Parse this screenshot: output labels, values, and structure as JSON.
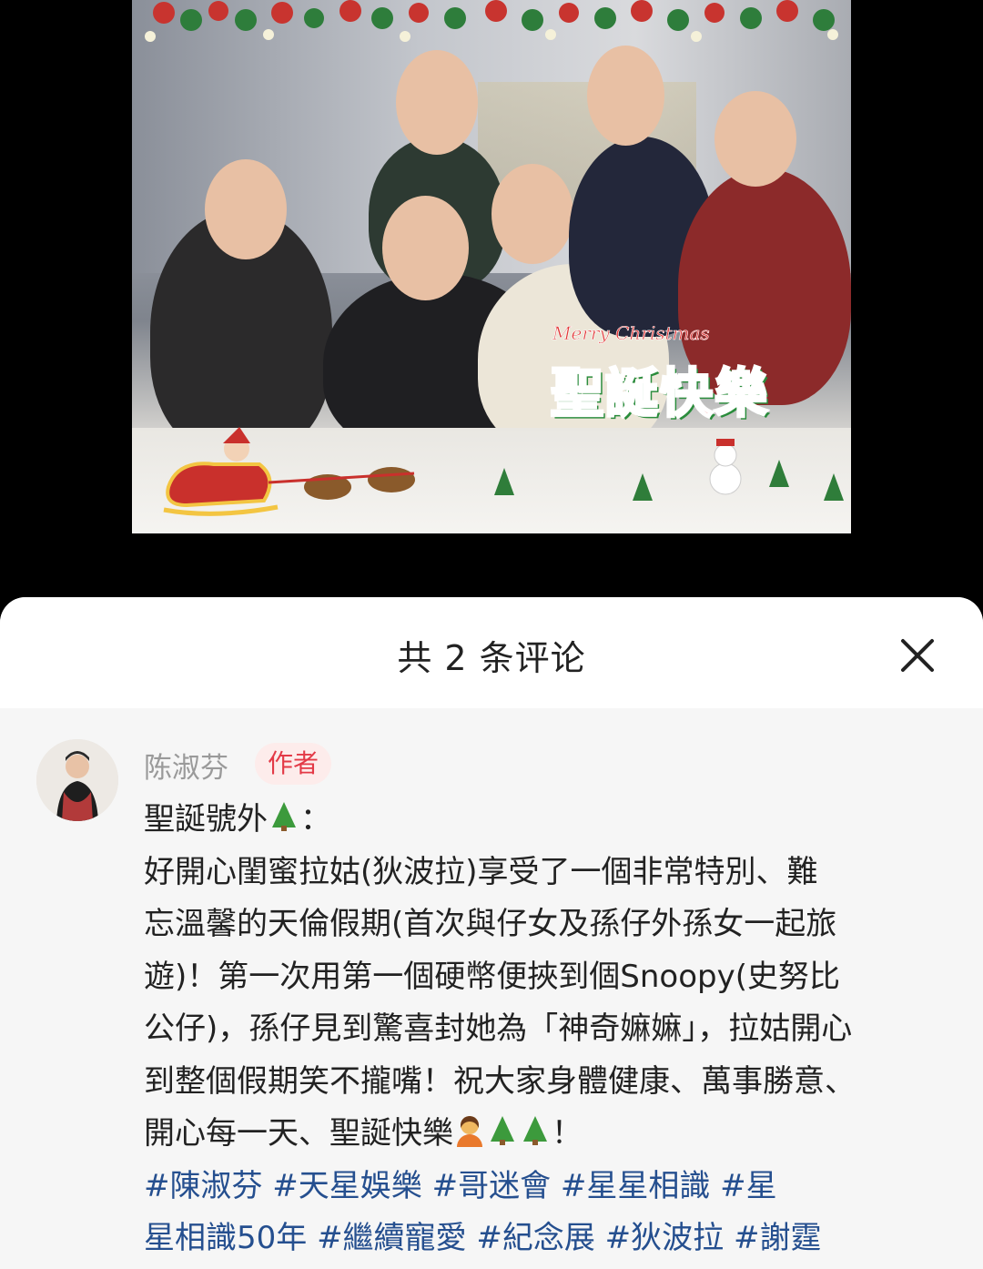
{
  "photo": {
    "sticker_merry": "Merry Christmas",
    "sticker_main": "聖誕快樂"
  },
  "sheet": {
    "title": "共 2 条评论",
    "close_icon": "close-icon"
  },
  "comment": {
    "author": "陈淑芬",
    "badge": "作者",
    "lines": [
      "聖誕號外",
      "好開心閨蜜拉姑(狄波拉)享受了一個非常特別、難",
      "忘溫馨的天倫假期(首次與仔女及孫仔外孫女一起旅",
      "遊)！第一次用第一個硬幣便挾到個Snoopy(史努比",
      "公仔)，孫仔見到驚喜封她為「神奇嫲嫲」，拉姑開心",
      "到整個假期笑不攏嘴！祝大家身體健康、萬事勝意、",
      "開心每一天、聖誕快樂"
    ],
    "line1_suffix": "：",
    "line7_suffix": "！",
    "hashtag_lines": [
      "#陳淑芬 #天星娛樂 #哥迷會  #星星相識 #星",
      "星相識50年 #繼續寵愛 #紀念展 #狄波拉 #謝霆"
    ]
  }
}
